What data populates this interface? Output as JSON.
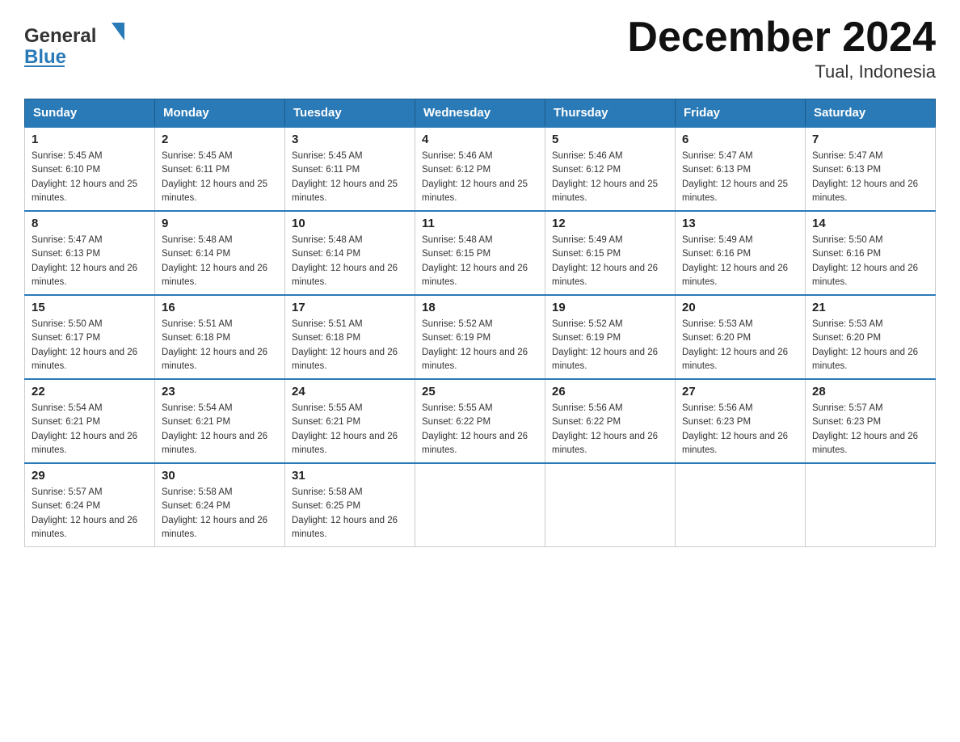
{
  "header": {
    "title": "December 2024",
    "subtitle": "Tual, Indonesia",
    "logo_general": "General",
    "logo_blue": "Blue"
  },
  "days_of_week": [
    "Sunday",
    "Monday",
    "Tuesday",
    "Wednesday",
    "Thursday",
    "Friday",
    "Saturday"
  ],
  "weeks": [
    [
      {
        "day": "1",
        "sunrise": "5:45 AM",
        "sunset": "6:10 PM",
        "daylight": "12 hours and 25 minutes."
      },
      {
        "day": "2",
        "sunrise": "5:45 AM",
        "sunset": "6:11 PM",
        "daylight": "12 hours and 25 minutes."
      },
      {
        "day": "3",
        "sunrise": "5:45 AM",
        "sunset": "6:11 PM",
        "daylight": "12 hours and 25 minutes."
      },
      {
        "day": "4",
        "sunrise": "5:46 AM",
        "sunset": "6:12 PM",
        "daylight": "12 hours and 25 minutes."
      },
      {
        "day": "5",
        "sunrise": "5:46 AM",
        "sunset": "6:12 PM",
        "daylight": "12 hours and 25 minutes."
      },
      {
        "day": "6",
        "sunrise": "5:47 AM",
        "sunset": "6:13 PM",
        "daylight": "12 hours and 25 minutes."
      },
      {
        "day": "7",
        "sunrise": "5:47 AM",
        "sunset": "6:13 PM",
        "daylight": "12 hours and 26 minutes."
      }
    ],
    [
      {
        "day": "8",
        "sunrise": "5:47 AM",
        "sunset": "6:13 PM",
        "daylight": "12 hours and 26 minutes."
      },
      {
        "day": "9",
        "sunrise": "5:48 AM",
        "sunset": "6:14 PM",
        "daylight": "12 hours and 26 minutes."
      },
      {
        "day": "10",
        "sunrise": "5:48 AM",
        "sunset": "6:14 PM",
        "daylight": "12 hours and 26 minutes."
      },
      {
        "day": "11",
        "sunrise": "5:48 AM",
        "sunset": "6:15 PM",
        "daylight": "12 hours and 26 minutes."
      },
      {
        "day": "12",
        "sunrise": "5:49 AM",
        "sunset": "6:15 PM",
        "daylight": "12 hours and 26 minutes."
      },
      {
        "day": "13",
        "sunrise": "5:49 AM",
        "sunset": "6:16 PM",
        "daylight": "12 hours and 26 minutes."
      },
      {
        "day": "14",
        "sunrise": "5:50 AM",
        "sunset": "6:16 PM",
        "daylight": "12 hours and 26 minutes."
      }
    ],
    [
      {
        "day": "15",
        "sunrise": "5:50 AM",
        "sunset": "6:17 PM",
        "daylight": "12 hours and 26 minutes."
      },
      {
        "day": "16",
        "sunrise": "5:51 AM",
        "sunset": "6:18 PM",
        "daylight": "12 hours and 26 minutes."
      },
      {
        "day": "17",
        "sunrise": "5:51 AM",
        "sunset": "6:18 PM",
        "daylight": "12 hours and 26 minutes."
      },
      {
        "day": "18",
        "sunrise": "5:52 AM",
        "sunset": "6:19 PM",
        "daylight": "12 hours and 26 minutes."
      },
      {
        "day": "19",
        "sunrise": "5:52 AM",
        "sunset": "6:19 PM",
        "daylight": "12 hours and 26 minutes."
      },
      {
        "day": "20",
        "sunrise": "5:53 AM",
        "sunset": "6:20 PM",
        "daylight": "12 hours and 26 minutes."
      },
      {
        "day": "21",
        "sunrise": "5:53 AM",
        "sunset": "6:20 PM",
        "daylight": "12 hours and 26 minutes."
      }
    ],
    [
      {
        "day": "22",
        "sunrise": "5:54 AM",
        "sunset": "6:21 PM",
        "daylight": "12 hours and 26 minutes."
      },
      {
        "day": "23",
        "sunrise": "5:54 AM",
        "sunset": "6:21 PM",
        "daylight": "12 hours and 26 minutes."
      },
      {
        "day": "24",
        "sunrise": "5:55 AM",
        "sunset": "6:21 PM",
        "daylight": "12 hours and 26 minutes."
      },
      {
        "day": "25",
        "sunrise": "5:55 AM",
        "sunset": "6:22 PM",
        "daylight": "12 hours and 26 minutes."
      },
      {
        "day": "26",
        "sunrise": "5:56 AM",
        "sunset": "6:22 PM",
        "daylight": "12 hours and 26 minutes."
      },
      {
        "day": "27",
        "sunrise": "5:56 AM",
        "sunset": "6:23 PM",
        "daylight": "12 hours and 26 minutes."
      },
      {
        "day": "28",
        "sunrise": "5:57 AM",
        "sunset": "6:23 PM",
        "daylight": "12 hours and 26 minutes."
      }
    ],
    [
      {
        "day": "29",
        "sunrise": "5:57 AM",
        "sunset": "6:24 PM",
        "daylight": "12 hours and 26 minutes."
      },
      {
        "day": "30",
        "sunrise": "5:58 AM",
        "sunset": "6:24 PM",
        "daylight": "12 hours and 26 minutes."
      },
      {
        "day": "31",
        "sunrise": "5:58 AM",
        "sunset": "6:25 PM",
        "daylight": "12 hours and 26 minutes."
      },
      null,
      null,
      null,
      null
    ]
  ]
}
